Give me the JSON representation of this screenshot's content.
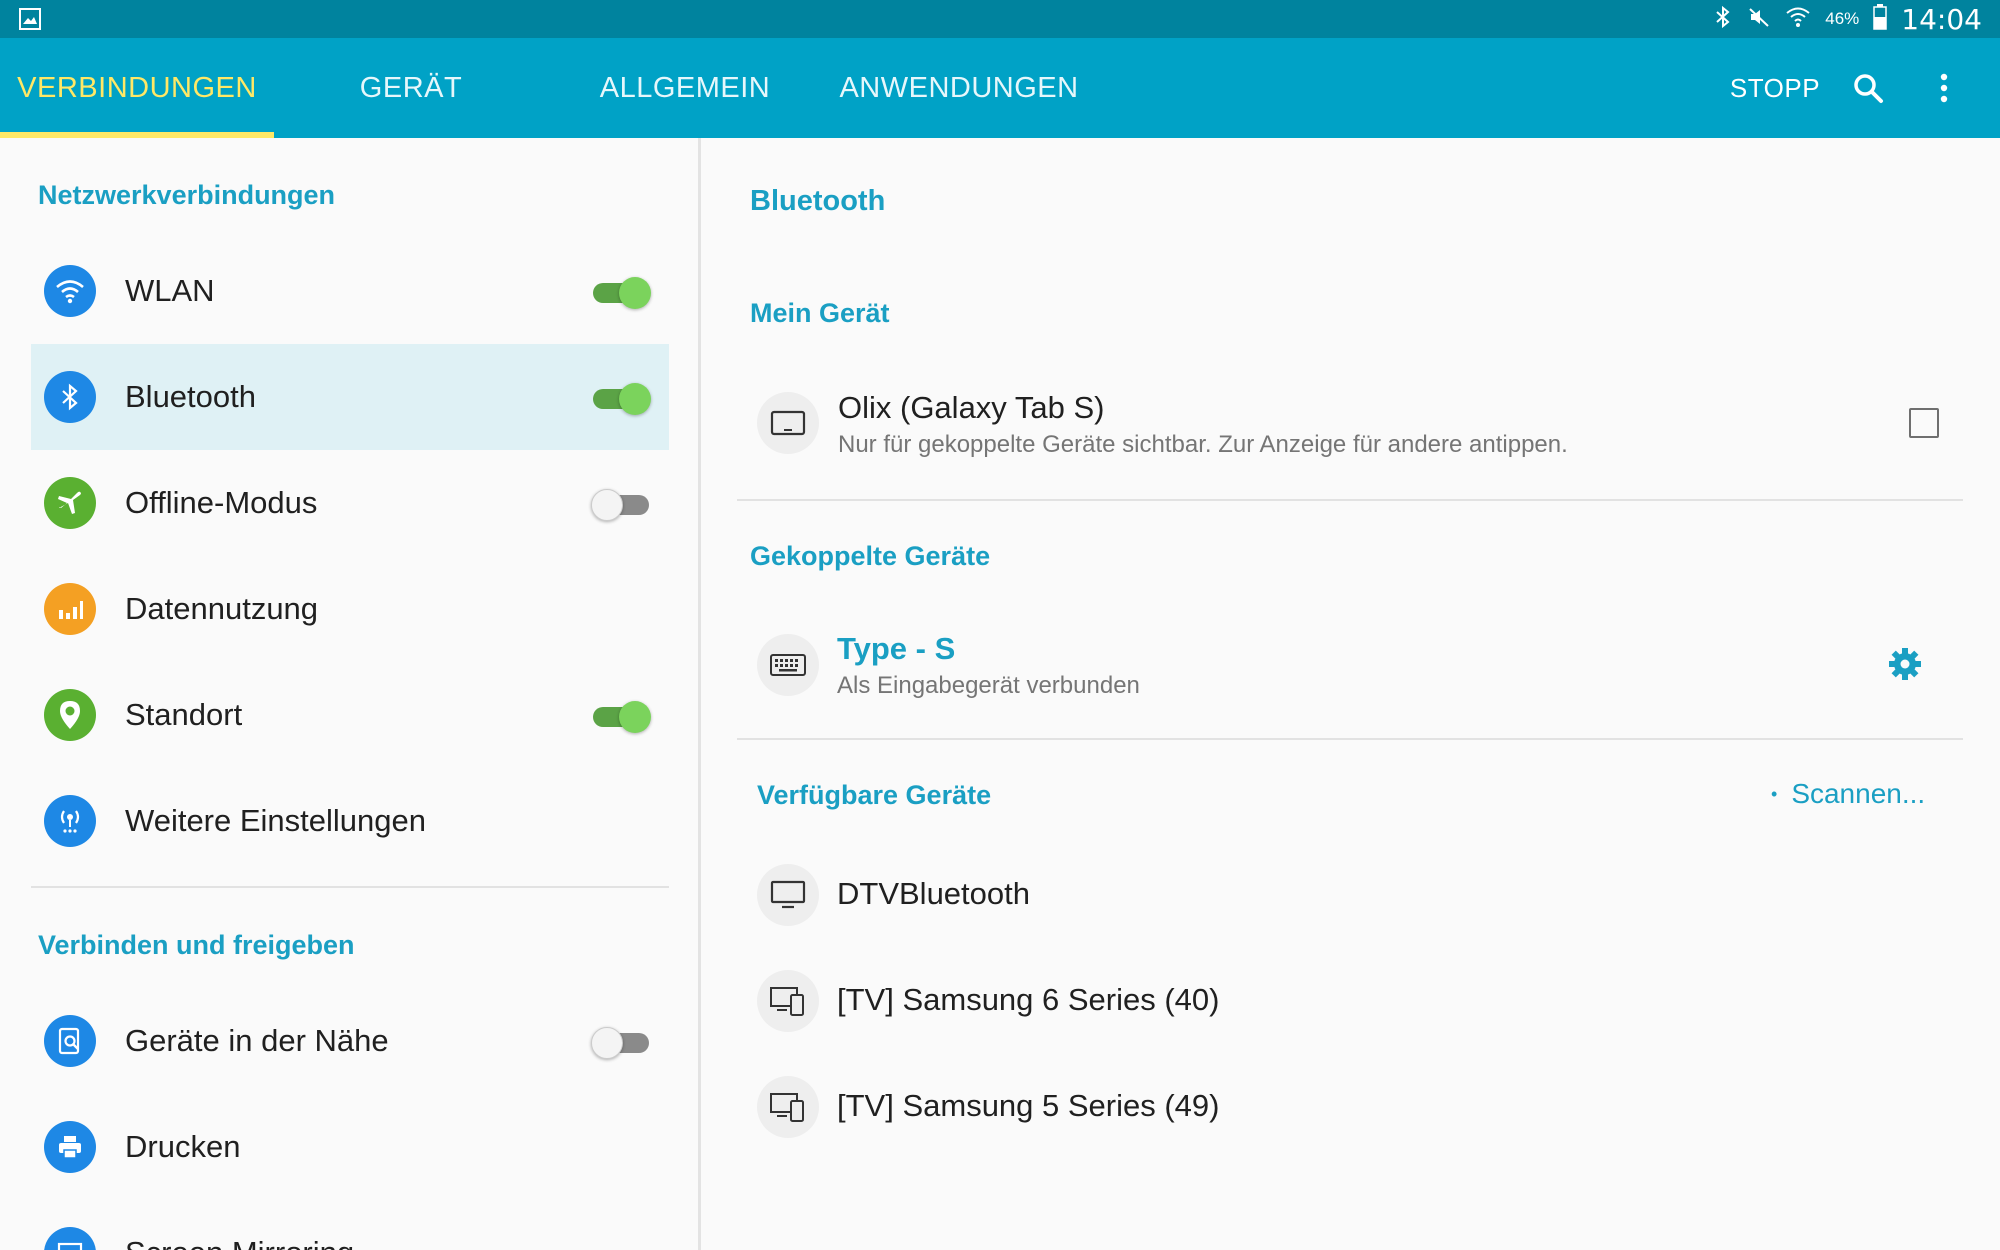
{
  "status_bar": {
    "battery_percent": "46%",
    "time": "14:04",
    "icons": [
      "gallery-icon",
      "bluetooth-icon",
      "mute-icon",
      "wifi-icon",
      "battery-icon"
    ]
  },
  "tabs": [
    {
      "label": "VERBINDUNGEN",
      "active": true
    },
    {
      "label": "GERÄT",
      "active": false
    },
    {
      "label": "ALLGEMEIN",
      "active": false
    },
    {
      "label": "ANWENDUNGEN",
      "active": false
    }
  ],
  "actions": {
    "stop_label": "STOPP",
    "icons": [
      "search-icon",
      "more-vert-icon"
    ]
  },
  "colors": {
    "appbar": "#00a2c6",
    "statusbar": "#00839e",
    "accent": "#1a9fc3",
    "active_tab": "#ffe866",
    "toggle_on": "#7bd35c"
  },
  "left": {
    "section1": "Netzwerkverbindungen",
    "items": [
      {
        "label": "WLAN",
        "icon": "wifi-icon",
        "color": "#1e88e5",
        "toggle": "on"
      },
      {
        "label": "Bluetooth",
        "icon": "bluetooth-icon",
        "color": "#1e88e5",
        "toggle": "on",
        "selected": true
      },
      {
        "label": "Offline-Modus",
        "icon": "airplane-icon",
        "color": "#5ab031",
        "toggle": "off"
      },
      {
        "label": "Datennutzung",
        "icon": "data-usage-icon",
        "color": "#f4a023",
        "toggle": null
      },
      {
        "label": "Standort",
        "icon": "location-icon",
        "color": "#5ab031",
        "toggle": "on"
      },
      {
        "label": "Weitere Einstellungen",
        "icon": "antenna-icon",
        "color": "#1e88e5",
        "toggle": null
      }
    ],
    "section2": "Verbinden und freigeben",
    "items2": [
      {
        "label": "Geräte in der Nähe",
        "icon": "nearby-devices-icon",
        "color": "#1e88e5",
        "toggle": "off"
      },
      {
        "label": "Drucken",
        "icon": "printer-icon",
        "color": "#1e88e5",
        "toggle": null
      },
      {
        "label": "Screen Mirroring",
        "icon": "screen-mirroring-icon",
        "color": "#1e88e5",
        "toggle": null
      }
    ]
  },
  "right": {
    "title": "Bluetooth",
    "my_device_header": "Mein Gerät",
    "my_device": {
      "name": "Olix (Galaxy Tab S)",
      "subtitle": "Nur für gekoppelte Geräte sichtbar. Zur Anzeige für andere antippen.",
      "icon": "tablet-icon",
      "checked": false
    },
    "paired_header": "Gekoppelte Geräte",
    "paired": [
      {
        "name": "Type - S",
        "subtitle": "Als Eingabegerät verbunden",
        "icon": "keyboard-icon",
        "action_icon": "gear-icon"
      }
    ],
    "available_header": "Verfügbare Geräte",
    "scan_label": "Scannen...",
    "available": [
      {
        "name": "DTVBluetooth",
        "icon": "monitor-icon"
      },
      {
        "name": "[TV] Samsung 6 Series (40)",
        "icon": "tv-devices-icon"
      },
      {
        "name": "[TV] Samsung 5 Series (49)",
        "icon": "tv-devices-icon"
      }
    ]
  }
}
